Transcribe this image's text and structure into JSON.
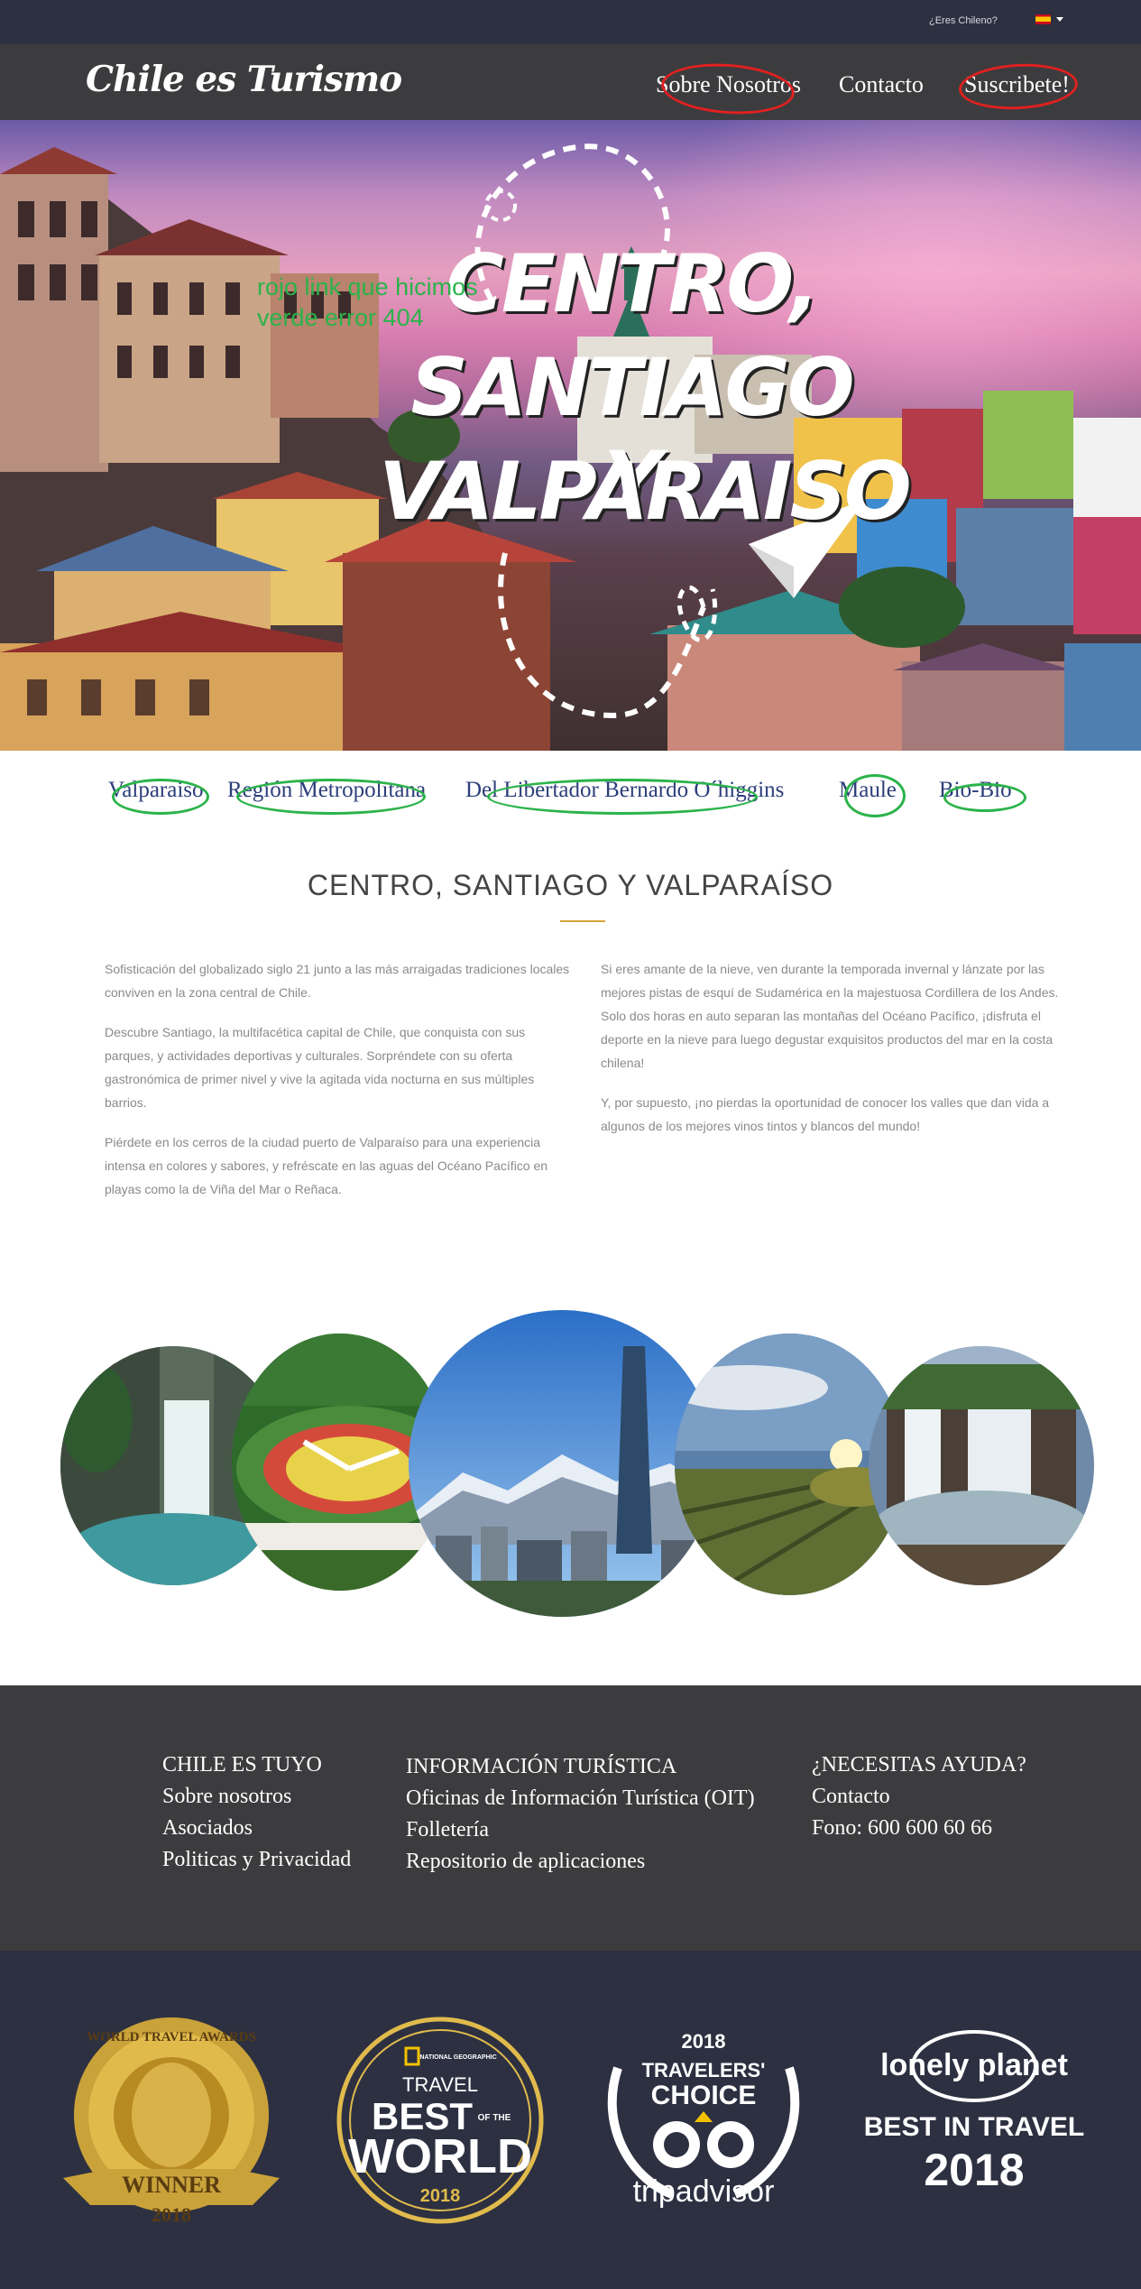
{
  "topbar": {
    "question": "¿Eres Chileno?",
    "language_flag": "spain-flag-icon"
  },
  "nav": {
    "logo": "Chile es Turismo",
    "items": [
      "Sobre Nosotros",
      "Contacto",
      "Suscribete!"
    ]
  },
  "hero": {
    "title_lines": [
      "CENTRO,",
      "SANTIAGO Y",
      "VALPARAISO"
    ],
    "annotation_lines": [
      "rojo link que hicimos",
      "verde error 404"
    ],
    "annotation_color": "#2bb34a",
    "highlight_color": "#e02020"
  },
  "regions": [
    "Valparaiso",
    "Región Metropolitana",
    "Del Libertador Bernardo O´higgins",
    "Maule",
    "Bio-Bio"
  ],
  "section": {
    "title": "CENTRO, SANTIAGO Y VALPARAÍSO",
    "left_paragraphs": [
      "Sofisticación del globalizado siglo 21 junto a las más arraigadas tradiciones locales conviven en la zona central de Chile.",
      "Descubre Santiago, la multifacética capital de Chile, que conquista con sus parques, y actividades deportivas y culturales. Sorpréndete con su oferta gastronómica de primer nivel y vive la agitada vida nocturna en sus múltiples barrios.",
      "Piérdete en los cerros de la ciudad puerto de Valparaíso para una experiencia intensa en colores y sabores, y refréscate en las aguas del Océano Pacífico en playas como la de Viña del Mar o Reñaca."
    ],
    "right_paragraphs": [
      "Si eres amante de la nieve, ven durante la temporada invernal y lánzate por las mejores pistas de esquí de Sudamérica en la majestuosa Cordillera de los Andes. Solo dos horas en auto separan las montañas del Océano Pacífico, ¡disfruta el deporte en la nieve para luego degustar exquisitos productos del mar en la costa chilena!",
      "Y, por supuesto, ¡no pierdas la oportunidad de conocer los valles que dan vida a algunos de los mejores vinos tintos y blancos del mundo!"
    ]
  },
  "gallery": [
    "waterfall-canyon-photo",
    "flower-clock-photo",
    "santiago-skyline-photo",
    "vineyard-sunset-photo",
    "waterfall-photo"
  ],
  "footer": {
    "col1": {
      "heading": "CHILE ES TUYO",
      "links": [
        "Sobre nosotros",
        "Asociados",
        "Politicas y Privacidad"
      ]
    },
    "col2": {
      "heading": "INFORMACIÓN TURÍSTICA",
      "links": [
        "Oficinas de Información Turística (OIT)",
        "Folletería",
        "Repositorio de aplicaciones"
      ]
    },
    "col3": {
      "heading": "¿NECESITAS AYUDA?",
      "links": [
        "Contacto",
        "Fono: 600 600 60 66"
      ]
    }
  },
  "awards": {
    "wta": {
      "text": "WORLD TRAVEL AWARDS",
      "label": "WINNER",
      "year": "2018"
    },
    "natgeo": {
      "brand": "NATIONAL GEOGRAPHIC",
      "line1": "TRAVEL",
      "line2": "BEST",
      "line2b": "OF THE",
      "line3": "WORLD",
      "year": "2018"
    },
    "tripadvisor": {
      "year": "2018",
      "line1": "TRAVELERS'",
      "line2": "CHOICE",
      "brand": "tripadvisor"
    },
    "lonelyplanet": {
      "brand": "lonely planet",
      "line1": "BEST IN TRAVEL",
      "year": "2018"
    }
  }
}
